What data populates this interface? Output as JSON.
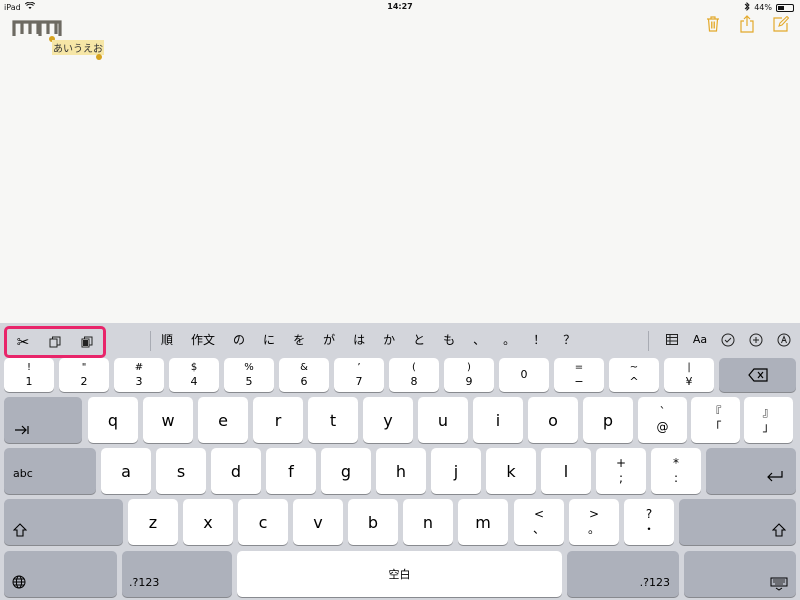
{
  "status_bar": {
    "device": "iPad",
    "time": "14:27",
    "battery_percent": "44%",
    "battery_level": 0.44
  },
  "note": {
    "selected_text": "あいうえお"
  },
  "keyboard": {
    "candidates": [
      "順",
      "作文",
      "の",
      "に",
      "を",
      "が",
      "は",
      "か",
      "と",
      "も",
      "、",
      "。",
      "！",
      "？"
    ],
    "number_row": [
      {
        "top": "!",
        "bottom": "1"
      },
      {
        "top": "\"",
        "bottom": "2"
      },
      {
        "top": "#",
        "bottom": "3"
      },
      {
        "top": "$",
        "bottom": "4"
      },
      {
        "top": "%",
        "bottom": "5"
      },
      {
        "top": "&",
        "bottom": "6"
      },
      {
        "top": "’",
        "bottom": "7"
      },
      {
        "top": "(",
        "bottom": "8"
      },
      {
        "top": ")",
        "bottom": "9"
      },
      {
        "top": "",
        "bottom": "0"
      },
      {
        "top": "=",
        "bottom": "−"
      },
      {
        "top": "~",
        "bottom": "^"
      },
      {
        "top": "|",
        "bottom": "¥"
      }
    ],
    "row1": [
      "q",
      "w",
      "e",
      "r",
      "t",
      "y",
      "u",
      "i",
      "o",
      "p"
    ],
    "row1_extra": [
      {
        "top": "`",
        "bottom": "@"
      },
      {
        "top": "『",
        "bottom": "「"
      },
      {
        "top": "』",
        "bottom": "」"
      }
    ],
    "row2": [
      "a",
      "s",
      "d",
      "f",
      "g",
      "h",
      "j",
      "k",
      "l"
    ],
    "row2_extra": [
      {
        "top": "+",
        "bottom": ";"
      },
      {
        "top": "*",
        "bottom": ":"
      }
    ],
    "row3": [
      "z",
      "x",
      "c",
      "v",
      "b",
      "n",
      "m"
    ],
    "row3_extra": [
      {
        "top": "<",
        "bottom": "、"
      },
      {
        "top": ">",
        "bottom": "。"
      },
      {
        "top": "?",
        "bottom": "・"
      }
    ],
    "abc_label": "abc",
    "num_label": ".?123",
    "space_label": "空白",
    "format_label": "Aa"
  }
}
